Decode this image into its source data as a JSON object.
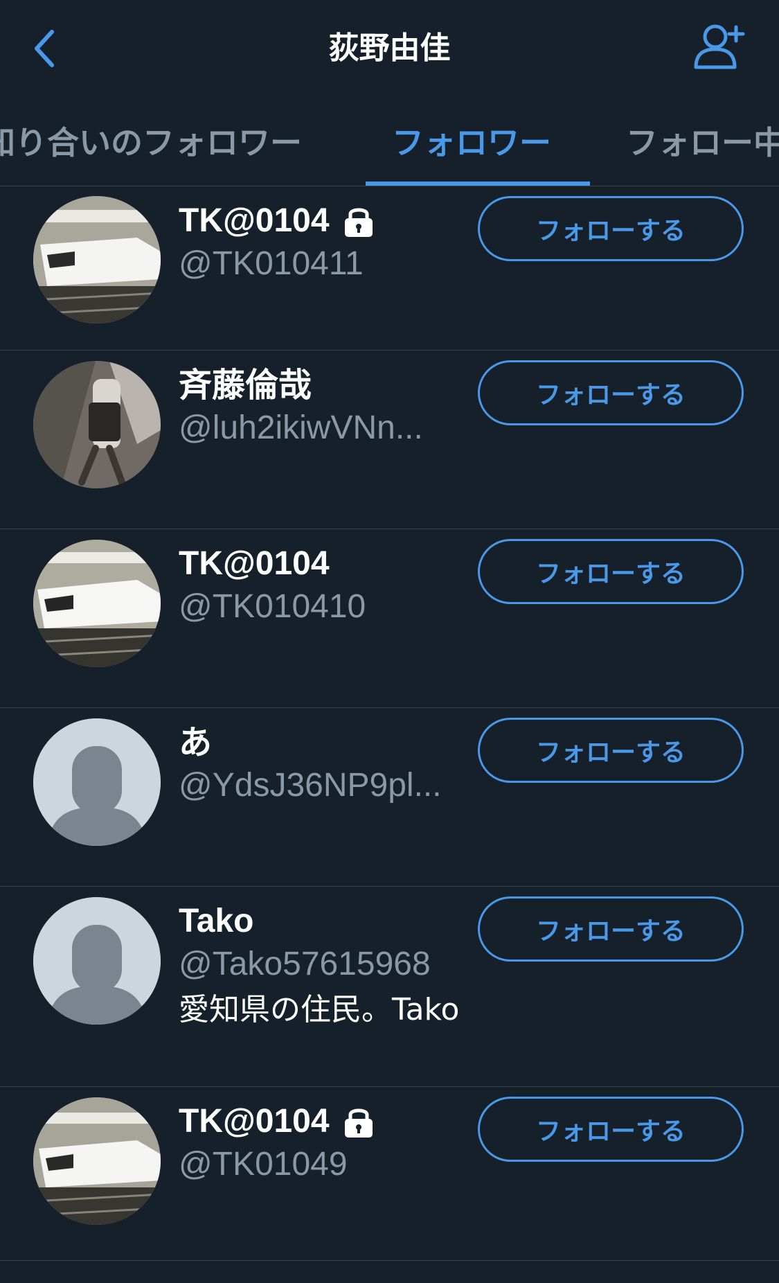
{
  "header": {
    "title": "荻野由佳",
    "back_icon": "chevron-left-icon",
    "add_user_icon": "add-user-icon",
    "accent": "#4a99e9"
  },
  "tabs": [
    {
      "label": "知り合いのフォロワー",
      "active": false
    },
    {
      "label": "フォロワー",
      "active": true
    },
    {
      "label": "フォロー中",
      "active": false
    }
  ],
  "followers": [
    {
      "name": "TK@0104",
      "handle": "@TK010411",
      "locked": true,
      "avatar": "train-photo",
      "bio": "",
      "button": "フォローする"
    },
    {
      "name": "斉藤倫哉",
      "handle": "@luh2ikiwVNn...",
      "locked": false,
      "avatar": "street-photo",
      "bio": "",
      "button": "フォローする"
    },
    {
      "name": "TK@0104",
      "handle": "@TK010410",
      "locked": false,
      "avatar": "train-photo",
      "bio": "",
      "button": "フォローする"
    },
    {
      "name": "あ",
      "handle": "@YdsJ36NP9pl...",
      "locked": false,
      "avatar": "default-avatar",
      "bio": "",
      "button": "フォローする"
    },
    {
      "name": "Tako",
      "handle": "@Tako57615968",
      "locked": false,
      "avatar": "default-avatar",
      "bio": "愛知県の住民。Tako",
      "button": "フォローする"
    },
    {
      "name": "TK@0104",
      "handle": "@TK01049",
      "locked": true,
      "avatar": "train-photo",
      "bio": "",
      "button": "フォローする"
    }
  ]
}
